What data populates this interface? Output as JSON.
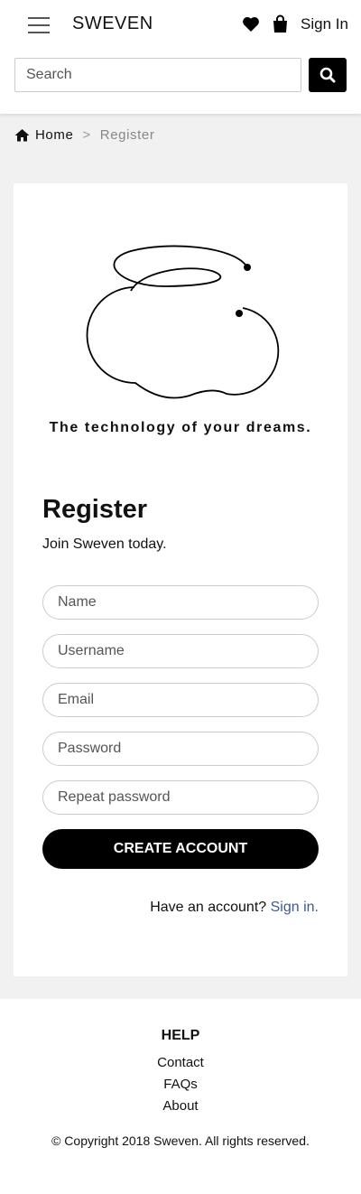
{
  "header": {
    "brand": "SWEVEN",
    "sign_in": "Sign In",
    "icons": {
      "menu": "hamburger-menu-icon",
      "wishlist": "heart-icon",
      "cart": "shopping-bag-icon",
      "search": "magnifier-icon"
    }
  },
  "search": {
    "placeholder": "Search",
    "value": ""
  },
  "breadcrumb": {
    "home": "Home",
    "separator": ">",
    "current": "Register"
  },
  "hero": {
    "tagline": "The technology of your dreams."
  },
  "register": {
    "title": "Register",
    "subtitle": "Join Sweven today.",
    "fields": [
      {
        "placeholder": "Name"
      },
      {
        "placeholder": "Username"
      },
      {
        "placeholder": "Email"
      },
      {
        "placeholder": "Password"
      },
      {
        "placeholder": "Repeat password"
      }
    ],
    "submit_label": "CREATE ACCOUNT",
    "have_account_text": "Have an account?",
    "sign_in_link": "Sign in."
  },
  "footer": {
    "help_title": "HELP",
    "links": [
      "Contact",
      "FAQs",
      "About"
    ],
    "copyright": "© Copyright 2018 Sweven. All rights reserved."
  },
  "colors": {
    "accent": "#000000",
    "link": "#3d5a8f",
    "background": "#f1f1f1"
  }
}
